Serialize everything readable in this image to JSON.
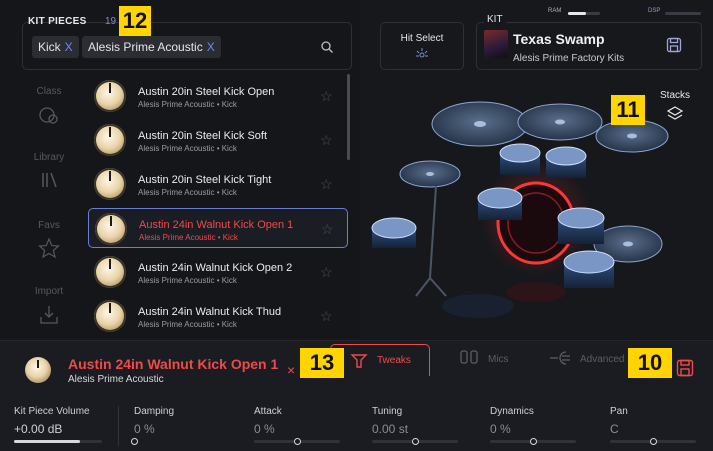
{
  "kit_pieces": {
    "header": "KIT PIECES",
    "count": "19",
    "search_chips": [
      {
        "label": "Kick",
        "x": "X"
      },
      {
        "label": "Alesis Prime Acoustic",
        "x": "X"
      }
    ]
  },
  "side_nav": [
    {
      "label": "Class",
      "icon": "class-icon"
    },
    {
      "label": "Library",
      "icon": "library-icon"
    },
    {
      "label": "Favs",
      "icon": "star-icon"
    },
    {
      "label": "Import",
      "icon": "import-icon"
    }
  ],
  "list": [
    {
      "title": "Austin 20in Steel Kick Open",
      "sub": "Alesis Prime Acoustic • Kick",
      "star": "☆"
    },
    {
      "title": "Austin 20in Steel Kick Soft",
      "sub": "Alesis Prime Acoustic • Kick",
      "star": "☆"
    },
    {
      "title": "Austin 20in Steel Kick Tight",
      "sub": "Alesis Prime Acoustic • Kick",
      "star": "☆"
    },
    {
      "title": "Austin 24in Walnut Kick Open 1",
      "sub": "Alesis Prime Acoustic • Kick",
      "star": "☆"
    },
    {
      "title": "Austin 24in Walnut Kick Open 2",
      "sub": "Alesis Prime Acoustic • Kick",
      "star": "☆"
    },
    {
      "title": "Austin 24in Walnut Kick Thud",
      "sub": "Alesis Prime Acoustic • Kick",
      "star": "☆"
    }
  ],
  "hit_select": {
    "label": "Hit Select"
  },
  "kit": {
    "tag": "KIT",
    "name": "Texas Swamp",
    "sub": "Alesis Prime Factory Kits"
  },
  "meters": {
    "ram_label": "RAM",
    "ram_level": 0.55,
    "dsp_label": "DSP",
    "dsp_level": 0.0
  },
  "stacks": {
    "label": "Stacks"
  },
  "badges": {
    "b12": "12",
    "b11": "11",
    "b13": "13",
    "b10": "10"
  },
  "selected": {
    "title": "Austin 24in Walnut Kick Open 1",
    "sub": "Alesis Prime Acoustic",
    "close": "×"
  },
  "tabs": [
    {
      "label": "Tweaks",
      "icon": "tweaks-icon",
      "active": true
    },
    {
      "label": "Mics",
      "icon": "mics-icon",
      "active": false
    },
    {
      "label": "Advanced",
      "icon": "advanced-icon",
      "active": false
    }
  ],
  "params": [
    {
      "label": "Kit Piece Volume",
      "value": "+0.00 dB",
      "level": 0.75
    },
    {
      "label": "Damping",
      "value": "0 %",
      "level": 0.0
    },
    {
      "label": "Attack",
      "value": "0 %",
      "level": 0.5
    },
    {
      "label": "Tuning",
      "value": "0.00 st",
      "level": 0.5
    },
    {
      "label": "Dynamics",
      "value": "0 %",
      "level": 0.5
    },
    {
      "label": "Pan",
      "value": "C",
      "level": 0.5
    }
  ],
  "colors": {
    "accent_red": "#ef4a4a",
    "accent_blue": "#6f86f0",
    "badge_yellow": "#ffd400"
  }
}
